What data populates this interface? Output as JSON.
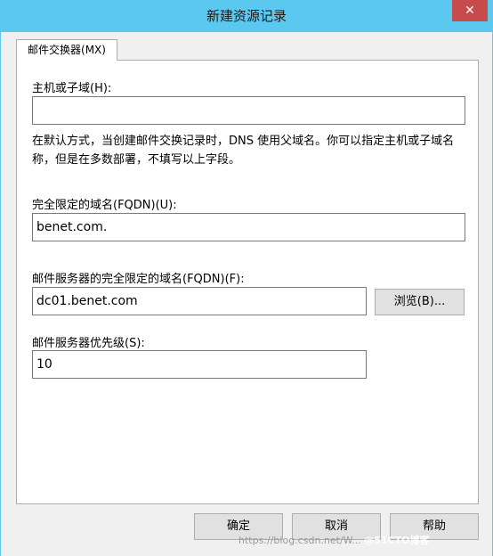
{
  "window": {
    "title": "新建资源记录",
    "close_glyph": "✕"
  },
  "tab": {
    "label": "邮件交换器(MX)"
  },
  "host": {
    "label": "主机或子域(H):",
    "value": ""
  },
  "description": "在默认方式，当创建邮件交换记录时，DNS 使用父域名。你可以指定主机或子域名称，但是在多数部署，不填写以上字段。",
  "fqdn": {
    "label": "完全限定的域名(FQDN)(U):",
    "value": "benet.com."
  },
  "mail_server": {
    "label": "邮件服务器的完全限定的域名(FQDN)(F):",
    "value": "dc01.benet.com",
    "browse_label": "浏览(B)..."
  },
  "priority": {
    "label": "邮件服务器优先级(S):",
    "value": "10"
  },
  "buttons": {
    "ok": "确定",
    "cancel": "取消",
    "help": "帮助"
  },
  "watermark": {
    "url": "https://blog.csdn.net/W...",
    "brand": "@51CTO博客"
  }
}
